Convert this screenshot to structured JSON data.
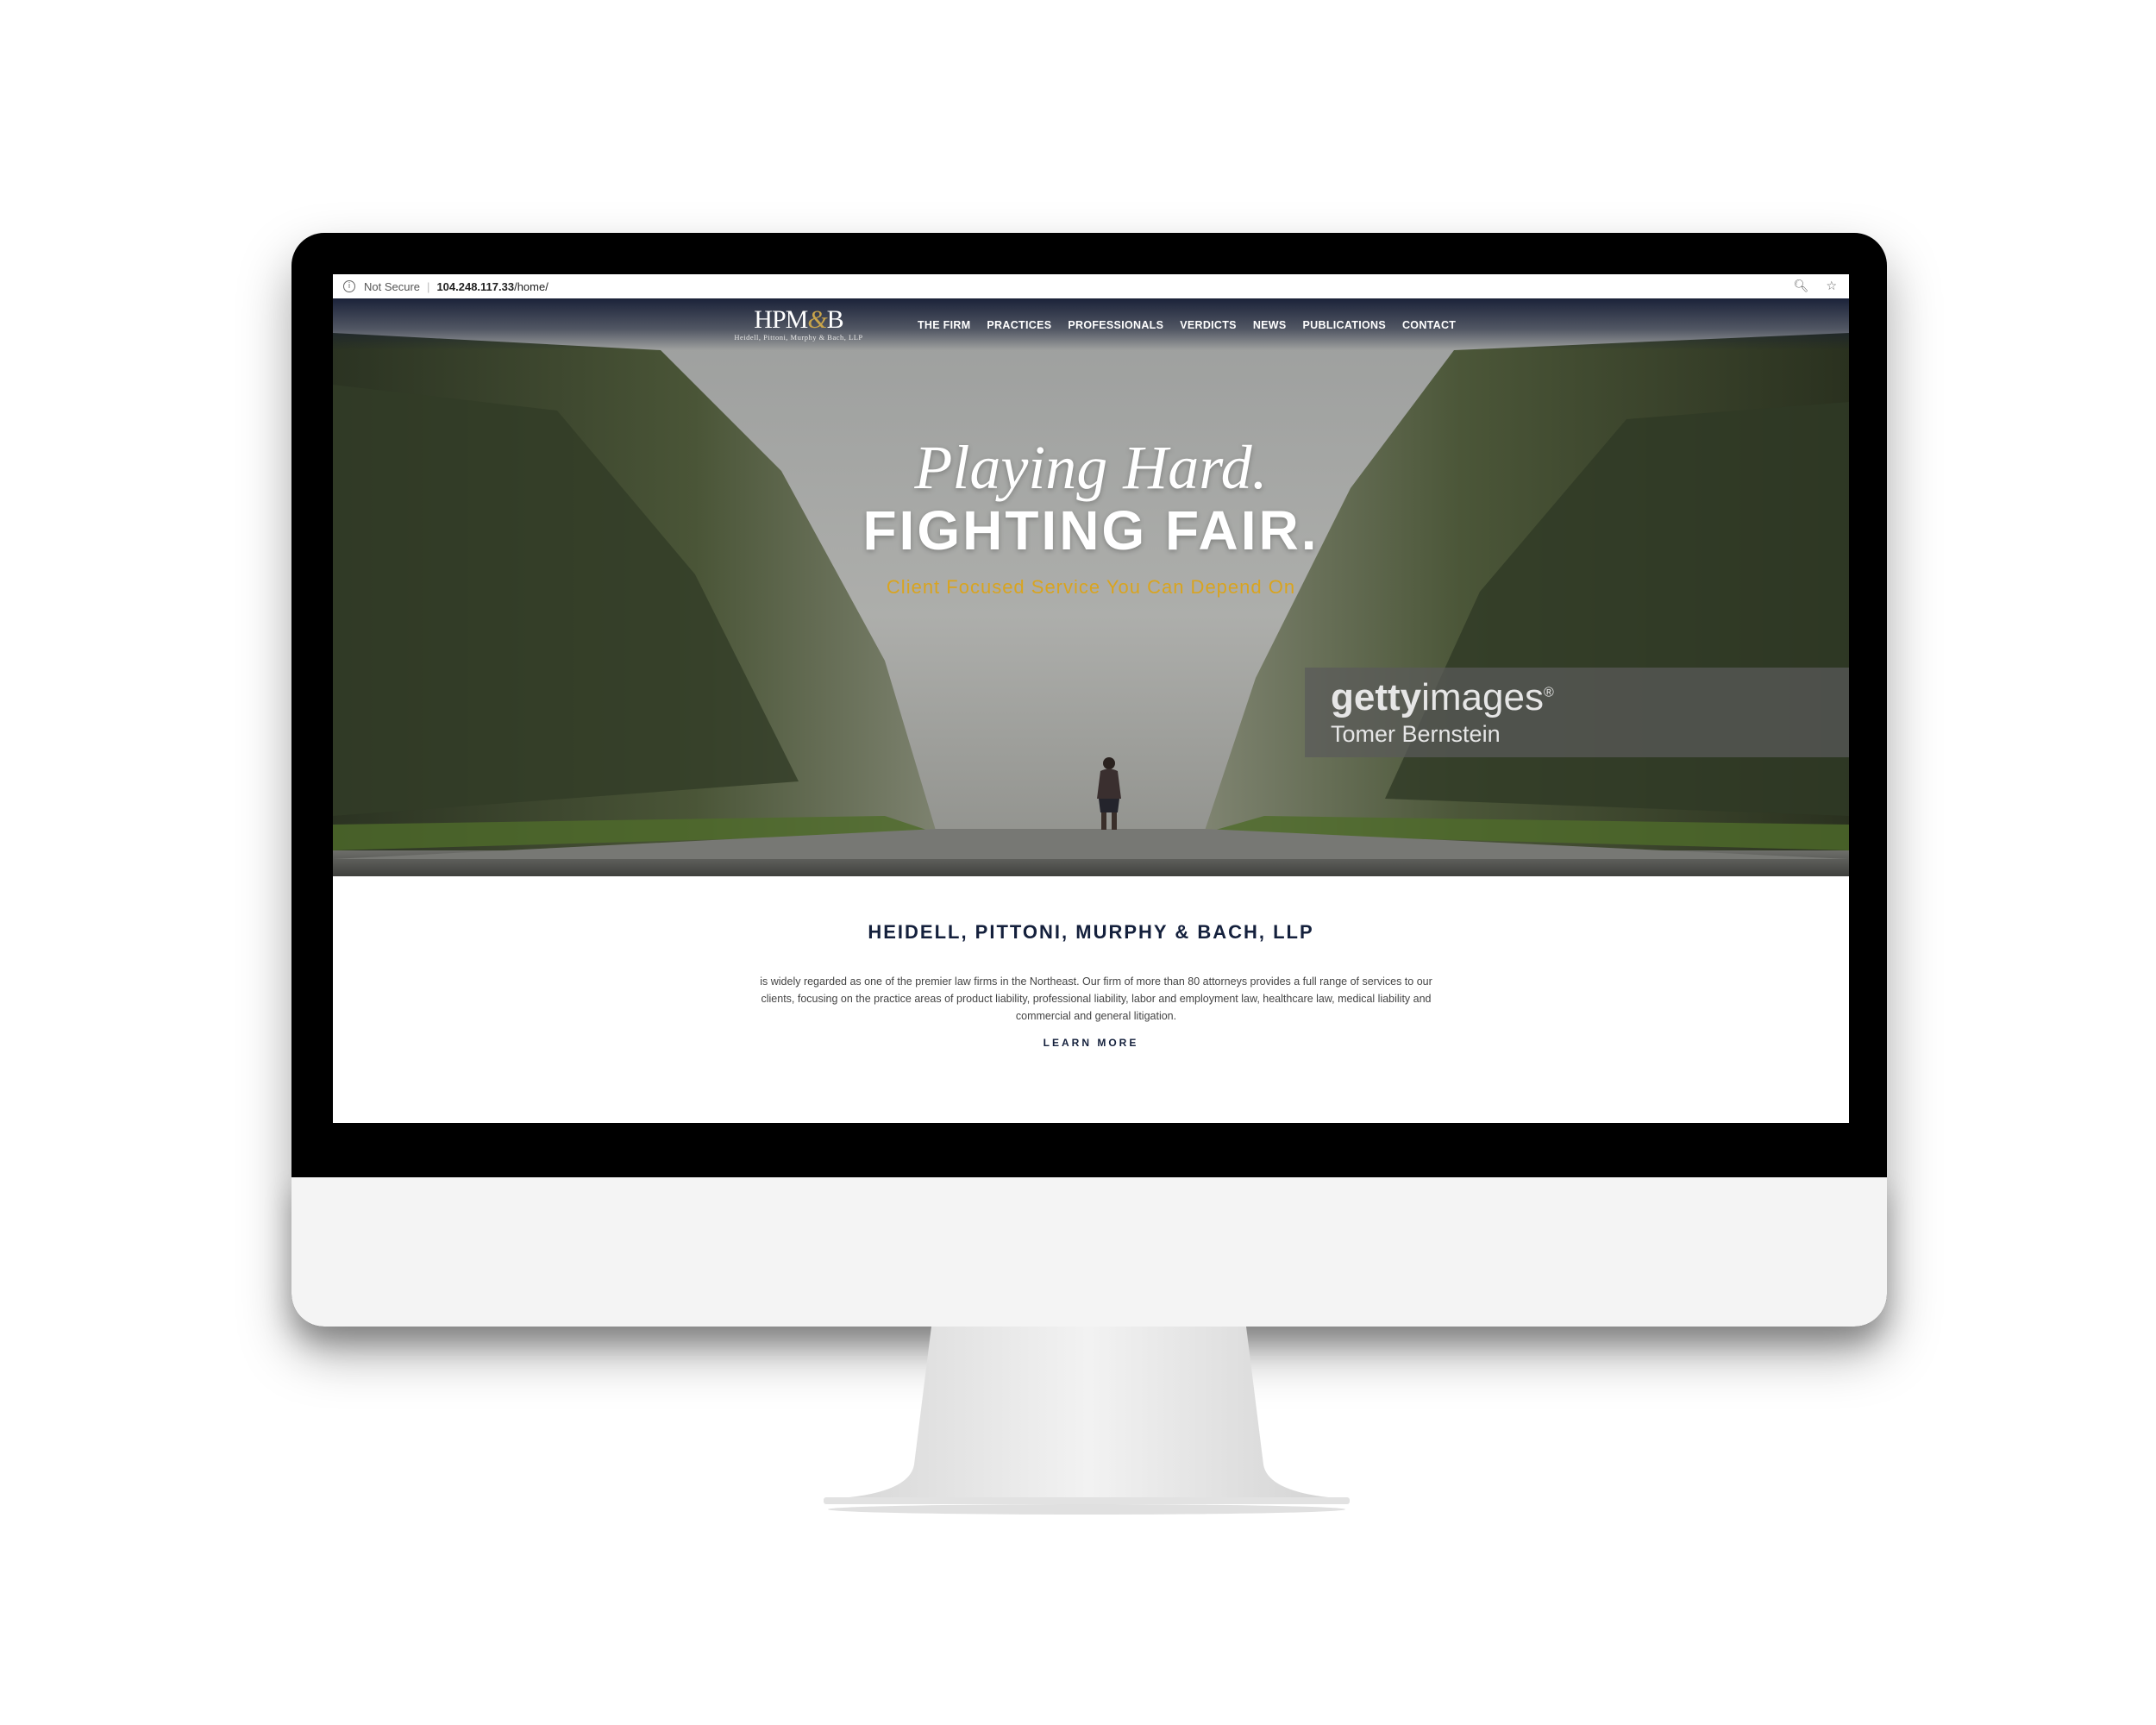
{
  "browser": {
    "security_label": "Not Secure",
    "url_host": "104.248.117.33",
    "url_path": "/home/"
  },
  "site": {
    "logo_mark": "HPM",
    "logo_amp": "&",
    "logo_mark_end": "B",
    "logo_sub": "Heidell, Pittoni, Murphy & Bach, LLP",
    "nav": [
      "THE FIRM",
      "PRACTICES",
      "PROFESSIONALS",
      "VERDICTS",
      "NEWS",
      "PUBLICATIONS",
      "CONTACT"
    ]
  },
  "hero": {
    "headline_italic": "Playing Hard.",
    "headline_bold": "FIGHTING FAIR.",
    "tagline": "Client Focused Service You Can Depend On",
    "watermark_brand_bold": "getty",
    "watermark_brand_light": "images",
    "watermark_reg": "®",
    "watermark_credit": "Tomer Bernstein"
  },
  "about": {
    "title": "HEIDELL, PITTONI, MURPHY & BACH, LLP",
    "description": "is widely regarded as one of the premier law firms in the Northeast. Our firm of more than 80 attorneys provides a full range of services to our clients, focusing on the practice areas of product liability, professional liability, labor and employment law, healthcare law, medical liability and commercial and general litigation.",
    "cta": "LEARN MORE"
  },
  "colors": {
    "navy": "#14203c",
    "gold": "#d9a41f",
    "monitor_bezel": "#000000",
    "monitor_chin": "#f4f4f4"
  }
}
